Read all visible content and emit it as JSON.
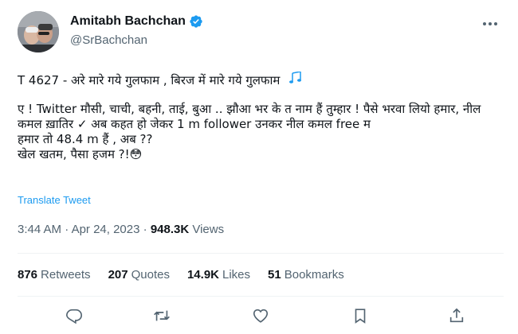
{
  "author": {
    "name": "Amitabh Bachchan",
    "handle": "@SrBachchan"
  },
  "tweet": {
    "line1": "T 4627 - अरे मारे गये गुलफाम  , बिरज में मारे गये गुलफाम",
    "paragraph2": "ए ! Twitter मौसी, चाची, बहनी, ताई, बुआ .. झौआ भर के त नाम हैं तुम्हार  ! पैसे भरवा लियो हमार, नील कमल ख़ातिर  ✓  अब कहत हो  जेकर 1 m follower  उनकर नील कमल free म\nहमार तो 48.4 m हैं  , अब ??\nखेल खतम, पैसा हजम ?!😳"
  },
  "translate_label": "Translate Tweet",
  "meta": {
    "time": "3:44 AM",
    "sep1": " · ",
    "date": "Apr 24, 2023",
    "sep2": " · ",
    "views_count": "948.3K",
    "views_label": " Views"
  },
  "stats": {
    "retweets_count": "876",
    "retweets_label": "Retweets",
    "quotes_count": "207",
    "quotes_label": "Quotes",
    "likes_count": "14.9K",
    "likes_label": "Likes",
    "bookmarks_count": "51",
    "bookmarks_label": "Bookmarks"
  },
  "icons": {
    "verified": "verified-badge-icon",
    "more": "more-options-icon",
    "reply": "reply-icon",
    "retweet": "retweet-icon",
    "like": "heart-icon",
    "bookmark": "bookmark-icon",
    "share": "share-icon"
  },
  "colors": {
    "accent": "#1d9bf0",
    "text": "#0f1419",
    "secondary": "#536471"
  }
}
